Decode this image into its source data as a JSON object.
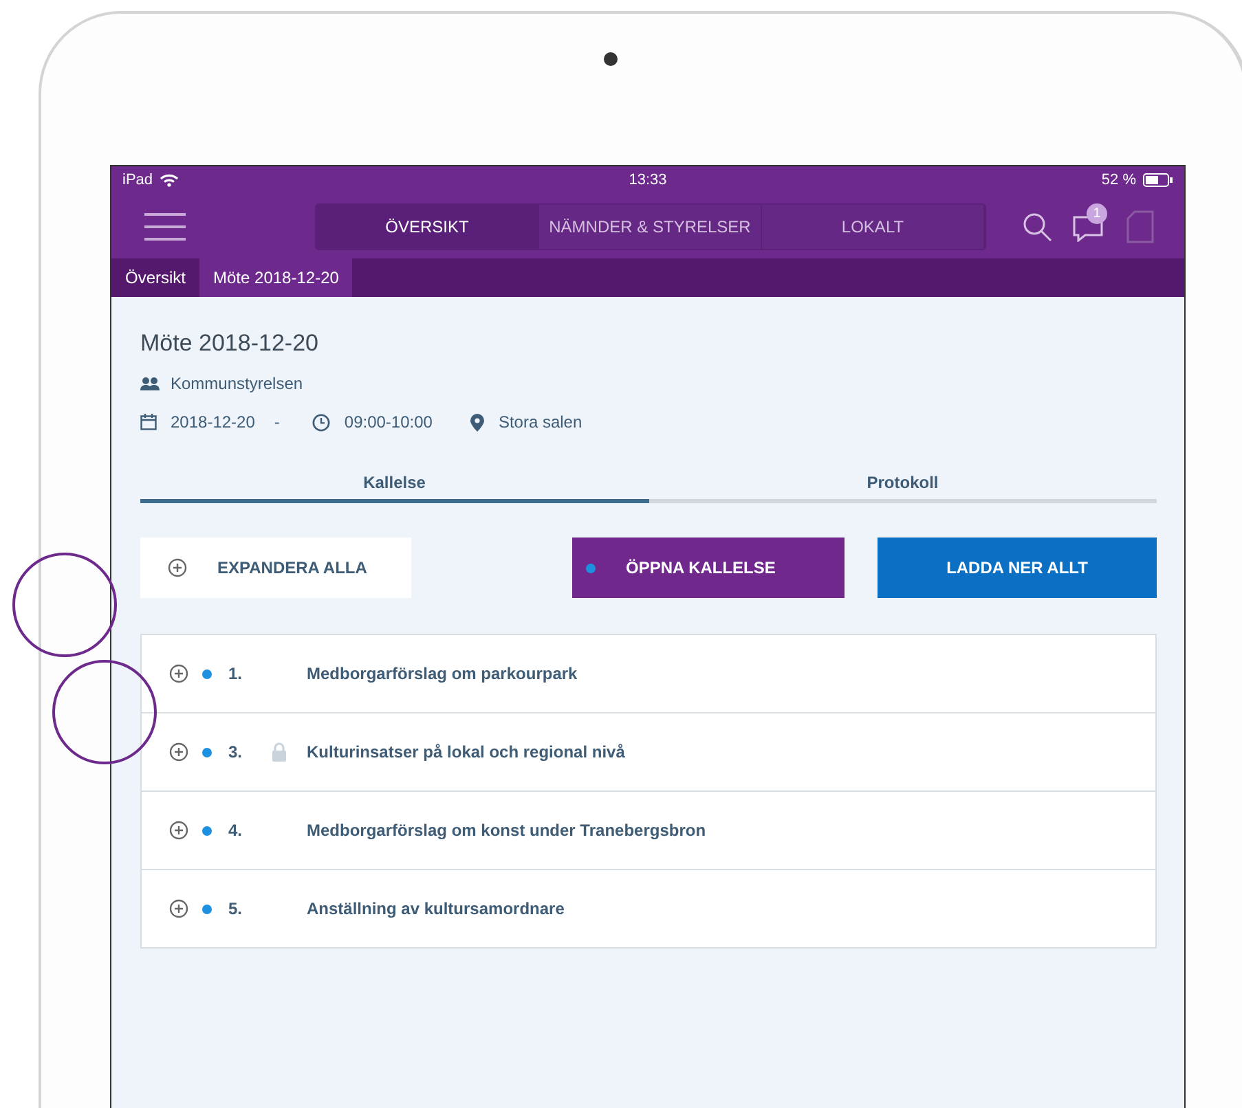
{
  "status_bar": {
    "device": "iPad",
    "time": "13:33",
    "battery": "52 %"
  },
  "nav": {
    "segments": [
      {
        "label": "ÖVERSIKT",
        "selected": true
      },
      {
        "label": "NÄMNDER & STYRELSER",
        "selected": false
      },
      {
        "label": "LOKALT",
        "selected": false
      }
    ],
    "badge": "1"
  },
  "breadcrumbs": [
    {
      "label": "Översikt",
      "selected": false
    },
    {
      "label": "Möte 2018-12-20",
      "selected": true
    }
  ],
  "meeting": {
    "title": "Möte 2018-12-20",
    "board": "Kommunstyrelsen",
    "date": "2018-12-20",
    "dash": "-",
    "time": "09:00-10:00",
    "place": "Stora salen"
  },
  "tabs": [
    {
      "label": "Kallelse",
      "selected": true
    },
    {
      "label": "Protokoll",
      "selected": false
    }
  ],
  "buttons": {
    "expand": "EXPANDERA ALLA",
    "open": "ÖPPNA KALLELSE",
    "download": "LADDA NER ALLT"
  },
  "items": [
    {
      "number": "1.",
      "title": "Medborgarförslag om parkourpark",
      "locked": false
    },
    {
      "number": "3.",
      "title": "Kulturinsatser på lokal och regional nivå",
      "locked": true
    },
    {
      "number": "4.",
      "title": "Medborgarförslag om konst under Tranebergsbron",
      "locked": false
    },
    {
      "number": "5.",
      "title": "Anställning av kultursamordnare",
      "locked": false
    }
  ]
}
